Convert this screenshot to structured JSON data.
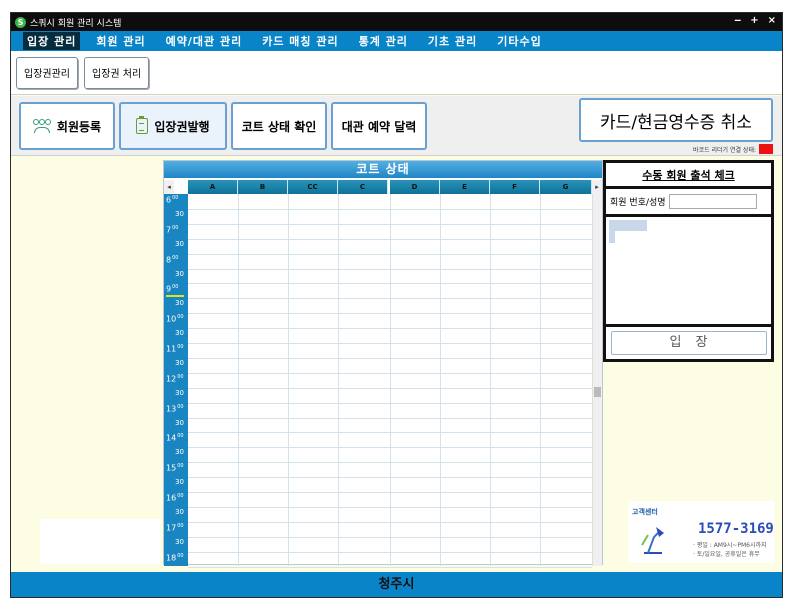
{
  "window": {
    "title": "스쿼시 회원 관리 시스템",
    "app_icon_glyph": "S",
    "controls": [
      "‒",
      "+",
      "×"
    ]
  },
  "menu": [
    "입장 관리",
    "회원 관리",
    "예약/대관 관리",
    "카드 매칭 관리",
    "통계 관리",
    "기초 관리",
    "기타수입"
  ],
  "subtabs": [
    "입장권관리",
    "입장권 처리"
  ],
  "toolbar": {
    "register": "회원등록",
    "issue": "입장권발행",
    "court_status": "코트 상태 확인",
    "rental_calendar": "대관 예약 달력",
    "cancel_receipt": "카드/현금영수증 취소",
    "barcode_label": "바코드 리더기 연결 상태:",
    "barcode_color": "#ee1111"
  },
  "court": {
    "title": "코트 상태",
    "columns": [
      "A",
      "B",
      "CC",
      "C",
      "D",
      "E",
      "F",
      "G"
    ],
    "times": [
      {
        "h": "6",
        "m": "00"
      },
      {
        "h": "",
        "m": "30"
      },
      {
        "h": "7",
        "m": "00"
      },
      {
        "h": "",
        "m": "30"
      },
      {
        "h": "8",
        "m": "00"
      },
      {
        "h": "",
        "m": "30"
      },
      {
        "h": "9",
        "m": "00"
      },
      {
        "h": "",
        "m": "30"
      },
      {
        "h": "10",
        "m": "00"
      },
      {
        "h": "",
        "m": "30"
      },
      {
        "h": "11",
        "m": "00"
      },
      {
        "h": "",
        "m": "30"
      },
      {
        "h": "12",
        "m": "00"
      },
      {
        "h": "",
        "m": "30"
      },
      {
        "h": "13",
        "m": "00"
      },
      {
        "h": "",
        "m": "30"
      },
      {
        "h": "14",
        "m": "00"
      },
      {
        "h": "",
        "m": "30"
      },
      {
        "h": "15",
        "m": "00"
      },
      {
        "h": "",
        "m": "30"
      },
      {
        "h": "16",
        "m": "00"
      },
      {
        "h": "",
        "m": "30"
      },
      {
        "h": "17",
        "m": "00"
      },
      {
        "h": "",
        "m": "30"
      },
      {
        "h": "18",
        "m": "00"
      }
    ],
    "scroll_left": "◂",
    "scroll_right": "▸"
  },
  "checkin": {
    "title": "수동 회원 출석 체크",
    "search_label": "회원 번호/성명",
    "search_value": "",
    "enter_button": "입장"
  },
  "customer_center": {
    "title": "고객센터",
    "phone": "1577-3169",
    "line1": "· 평일 : AM9시~PM6시까지",
    "line2": "· 토/일요일, 공휴일은 휴무"
  },
  "footer": "청주시",
  "colors": {
    "menu": "#0a84c8",
    "footer": "#0a84c8",
    "background": "#fdfde4"
  }
}
